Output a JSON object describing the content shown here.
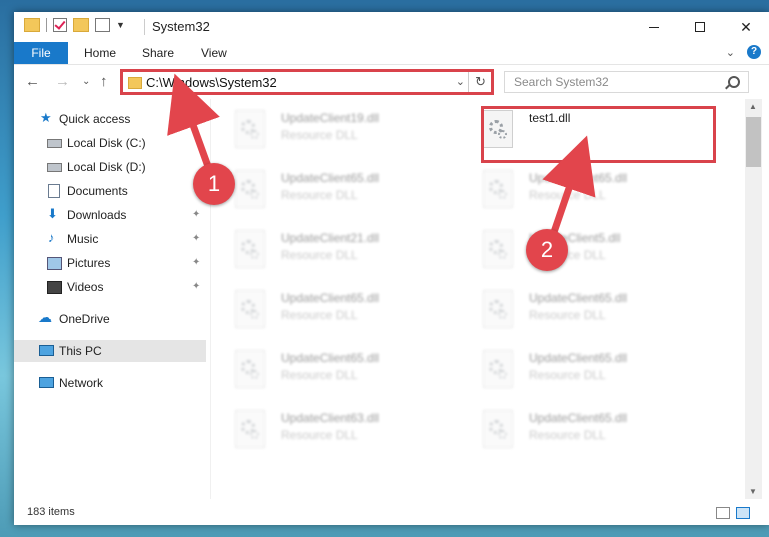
{
  "window": {
    "title": "System32",
    "controls": {
      "minimize": "",
      "maximize": "",
      "close": "✕"
    }
  },
  "ribbon": {
    "tabs": [
      "File",
      "Home",
      "Share",
      "View"
    ],
    "collapse": "⌄",
    "help": "?"
  },
  "nav": {
    "back": "←",
    "forward": "→",
    "recent": "⌄",
    "up": "↑",
    "address": "C:\\Windows\\System32",
    "address_dropdown": "⌄",
    "refresh": "↻",
    "search_placeholder": "Search System32"
  },
  "sidebar": {
    "items": [
      {
        "label": "Quick access",
        "icon": "star-icon",
        "pin": ""
      },
      {
        "label": "Local Disk (C:)",
        "icon": "disk-icon",
        "pin": ""
      },
      {
        "label": "Local Disk (D:)",
        "icon": "disk-icon",
        "pin": ""
      },
      {
        "label": "Documents",
        "icon": "documents-icon",
        "pin": ""
      },
      {
        "label": "Downloads",
        "icon": "download-icon",
        "pin": "📌"
      },
      {
        "label": "Music",
        "icon": "music-icon",
        "pin": "📌"
      },
      {
        "label": "Pictures",
        "icon": "pictures-icon",
        "pin": "📌"
      },
      {
        "label": "Videos",
        "icon": "videos-icon",
        "pin": "📌"
      },
      {
        "label": "OneDrive",
        "icon": "cloud-icon",
        "pin": ""
      },
      {
        "label": "This PC",
        "icon": "computer-icon",
        "pin": ""
      },
      {
        "label": "Network",
        "icon": "network-icon",
        "pin": ""
      }
    ]
  },
  "files": [
    {
      "name": "UpdateClient19.dll",
      "type": "Resource DLL"
    },
    {
      "name": "test1.dll",
      "type": ""
    },
    {
      "name": "UpdateClient65.dll",
      "type": "Resource DLL"
    },
    {
      "name": "UpdateClient65.dll",
      "type": "Resource DLL"
    },
    {
      "name": "UpdateClient21.dll",
      "type": "Resource DLL"
    },
    {
      "name": "UpdateClient5.dll",
      "type": "Resource DLL"
    },
    {
      "name": "UpdateClient65.dll",
      "type": "Resource DLL"
    },
    {
      "name": "UpdateClient65.dll",
      "type": "Resource DLL"
    },
    {
      "name": "UpdateClient65.dll",
      "type": "Resource DLL"
    },
    {
      "name": "UpdateClient65.dll",
      "type": "Resource DLL"
    },
    {
      "name": "UpdateClient63.dll",
      "type": "Resource DLL"
    },
    {
      "name": "UpdateClient65.dll",
      "type": "Resource DLL"
    }
  ],
  "status": {
    "items": "183 items"
  },
  "annotations": {
    "step1": "1",
    "step2": "2",
    "color": "#e2454c"
  },
  "colors": {
    "accent": "#1979ca",
    "highlight": "#d9434b"
  }
}
